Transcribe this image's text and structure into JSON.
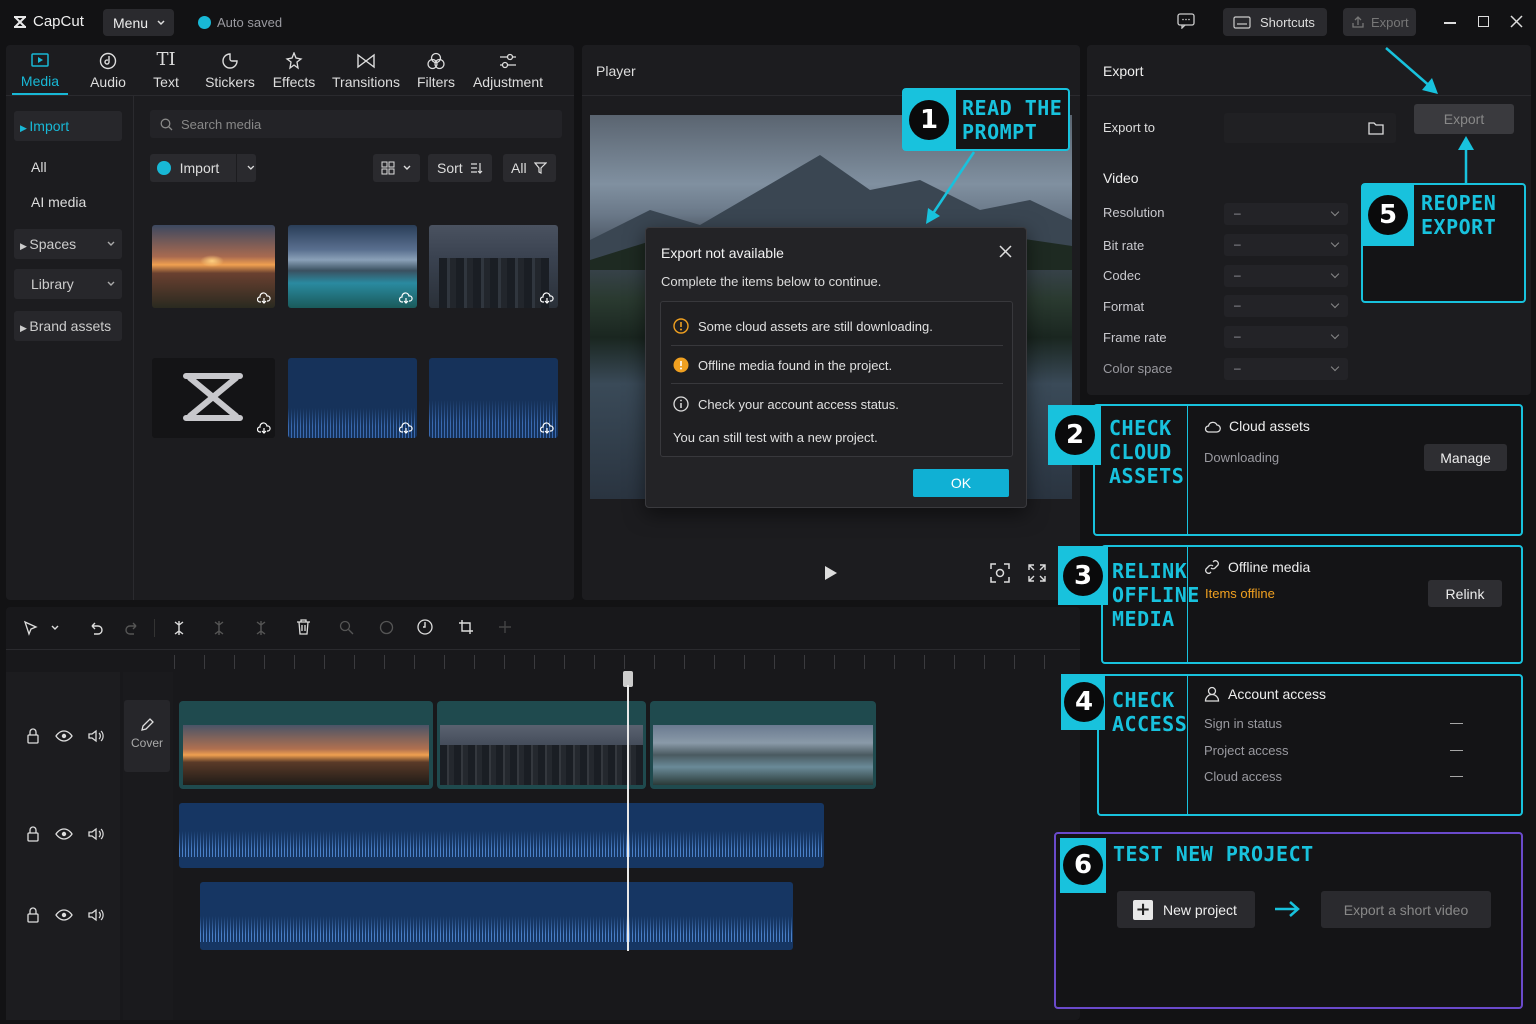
{
  "app": {
    "name": "CapCut",
    "menu_label": "Menu",
    "autosave": "Auto saved",
    "shortcuts_label": "Shortcuts",
    "export_label": "Export"
  },
  "tabs": [
    {
      "label": "Media",
      "icon": "media-icon"
    },
    {
      "label": "Audio",
      "icon": "audio-icon"
    },
    {
      "label": "Text",
      "icon": "text-icon"
    },
    {
      "label": "Stickers",
      "icon": "stickers-icon"
    },
    {
      "label": "Effects",
      "icon": "effects-icon"
    },
    {
      "label": "Transitions",
      "icon": "transitions-icon"
    },
    {
      "label": "Filters",
      "icon": "filters-icon"
    },
    {
      "label": "Adjustment",
      "icon": "adjustment-icon"
    }
  ],
  "sidebar": {
    "import": "Import",
    "all": "All",
    "ai_media": "AI media",
    "spaces": "Spaces",
    "library": "Library",
    "brand": "Brand assets"
  },
  "media": {
    "search_placeholder": "Search media",
    "import_btn": "Import",
    "sort": "Sort",
    "filter_all": "All"
  },
  "player": {
    "title": "Player"
  },
  "dialog": {
    "title": "Export not available",
    "subtitle": "Complete the items below to continue.",
    "items": [
      "Some cloud assets are still downloading.",
      "Offline media found in the project.",
      "Check your account access status."
    ],
    "note": "You can still test with a new project.",
    "ok": "OK"
  },
  "export_panel": {
    "title": "Export",
    "export_to": "Export to",
    "export_btn": "Export",
    "video_label": "Video",
    "settings": [
      {
        "label": "Resolution",
        "value": "–"
      },
      {
        "label": "Bit rate",
        "value": "–"
      },
      {
        "label": "Codec",
        "value": "–"
      },
      {
        "label": "Format",
        "value": "–"
      },
      {
        "label": "Frame rate",
        "value": "–"
      },
      {
        "label": "Color space",
        "value": "–"
      }
    ]
  },
  "callouts": [
    {
      "num": "1",
      "text": [
        "READ THE",
        "PROMPT"
      ]
    },
    {
      "num": "2",
      "text": [
        "CHECK",
        "CLOUD",
        "ASSETS"
      ]
    },
    {
      "num": "3",
      "text": [
        "RELINK",
        "OFFLINE",
        "MEDIA"
      ]
    },
    {
      "num": "4",
      "text": [
        "CHECK",
        "ACCESS"
      ]
    },
    {
      "num": "5",
      "text": [
        "REOPEN",
        "EXPORT"
      ]
    },
    {
      "num": "6",
      "text": [
        "TEST NEW PROJECT"
      ]
    }
  ],
  "cloud": {
    "title": "Cloud assets",
    "status": "Downloading",
    "btn": "Manage"
  },
  "offline": {
    "title": "Offline media",
    "status": "Items offline",
    "btn": "Relink"
  },
  "access": {
    "title": "Account access",
    "rows": [
      {
        "label": "Sign in status",
        "value": "—"
      },
      {
        "label": "Project access",
        "value": "—"
      },
      {
        "label": "Cloud access",
        "value": "—"
      }
    ]
  },
  "newproj": {
    "btn": "New project",
    "export_short": "Export a short video"
  },
  "timeline": {
    "cover": "Cover"
  },
  "colors": {
    "accent": "#18b8d6",
    "warning": "#f0a020",
    "bg": "#121214",
    "panel": "#1c1c1f",
    "audio": "#163663"
  }
}
